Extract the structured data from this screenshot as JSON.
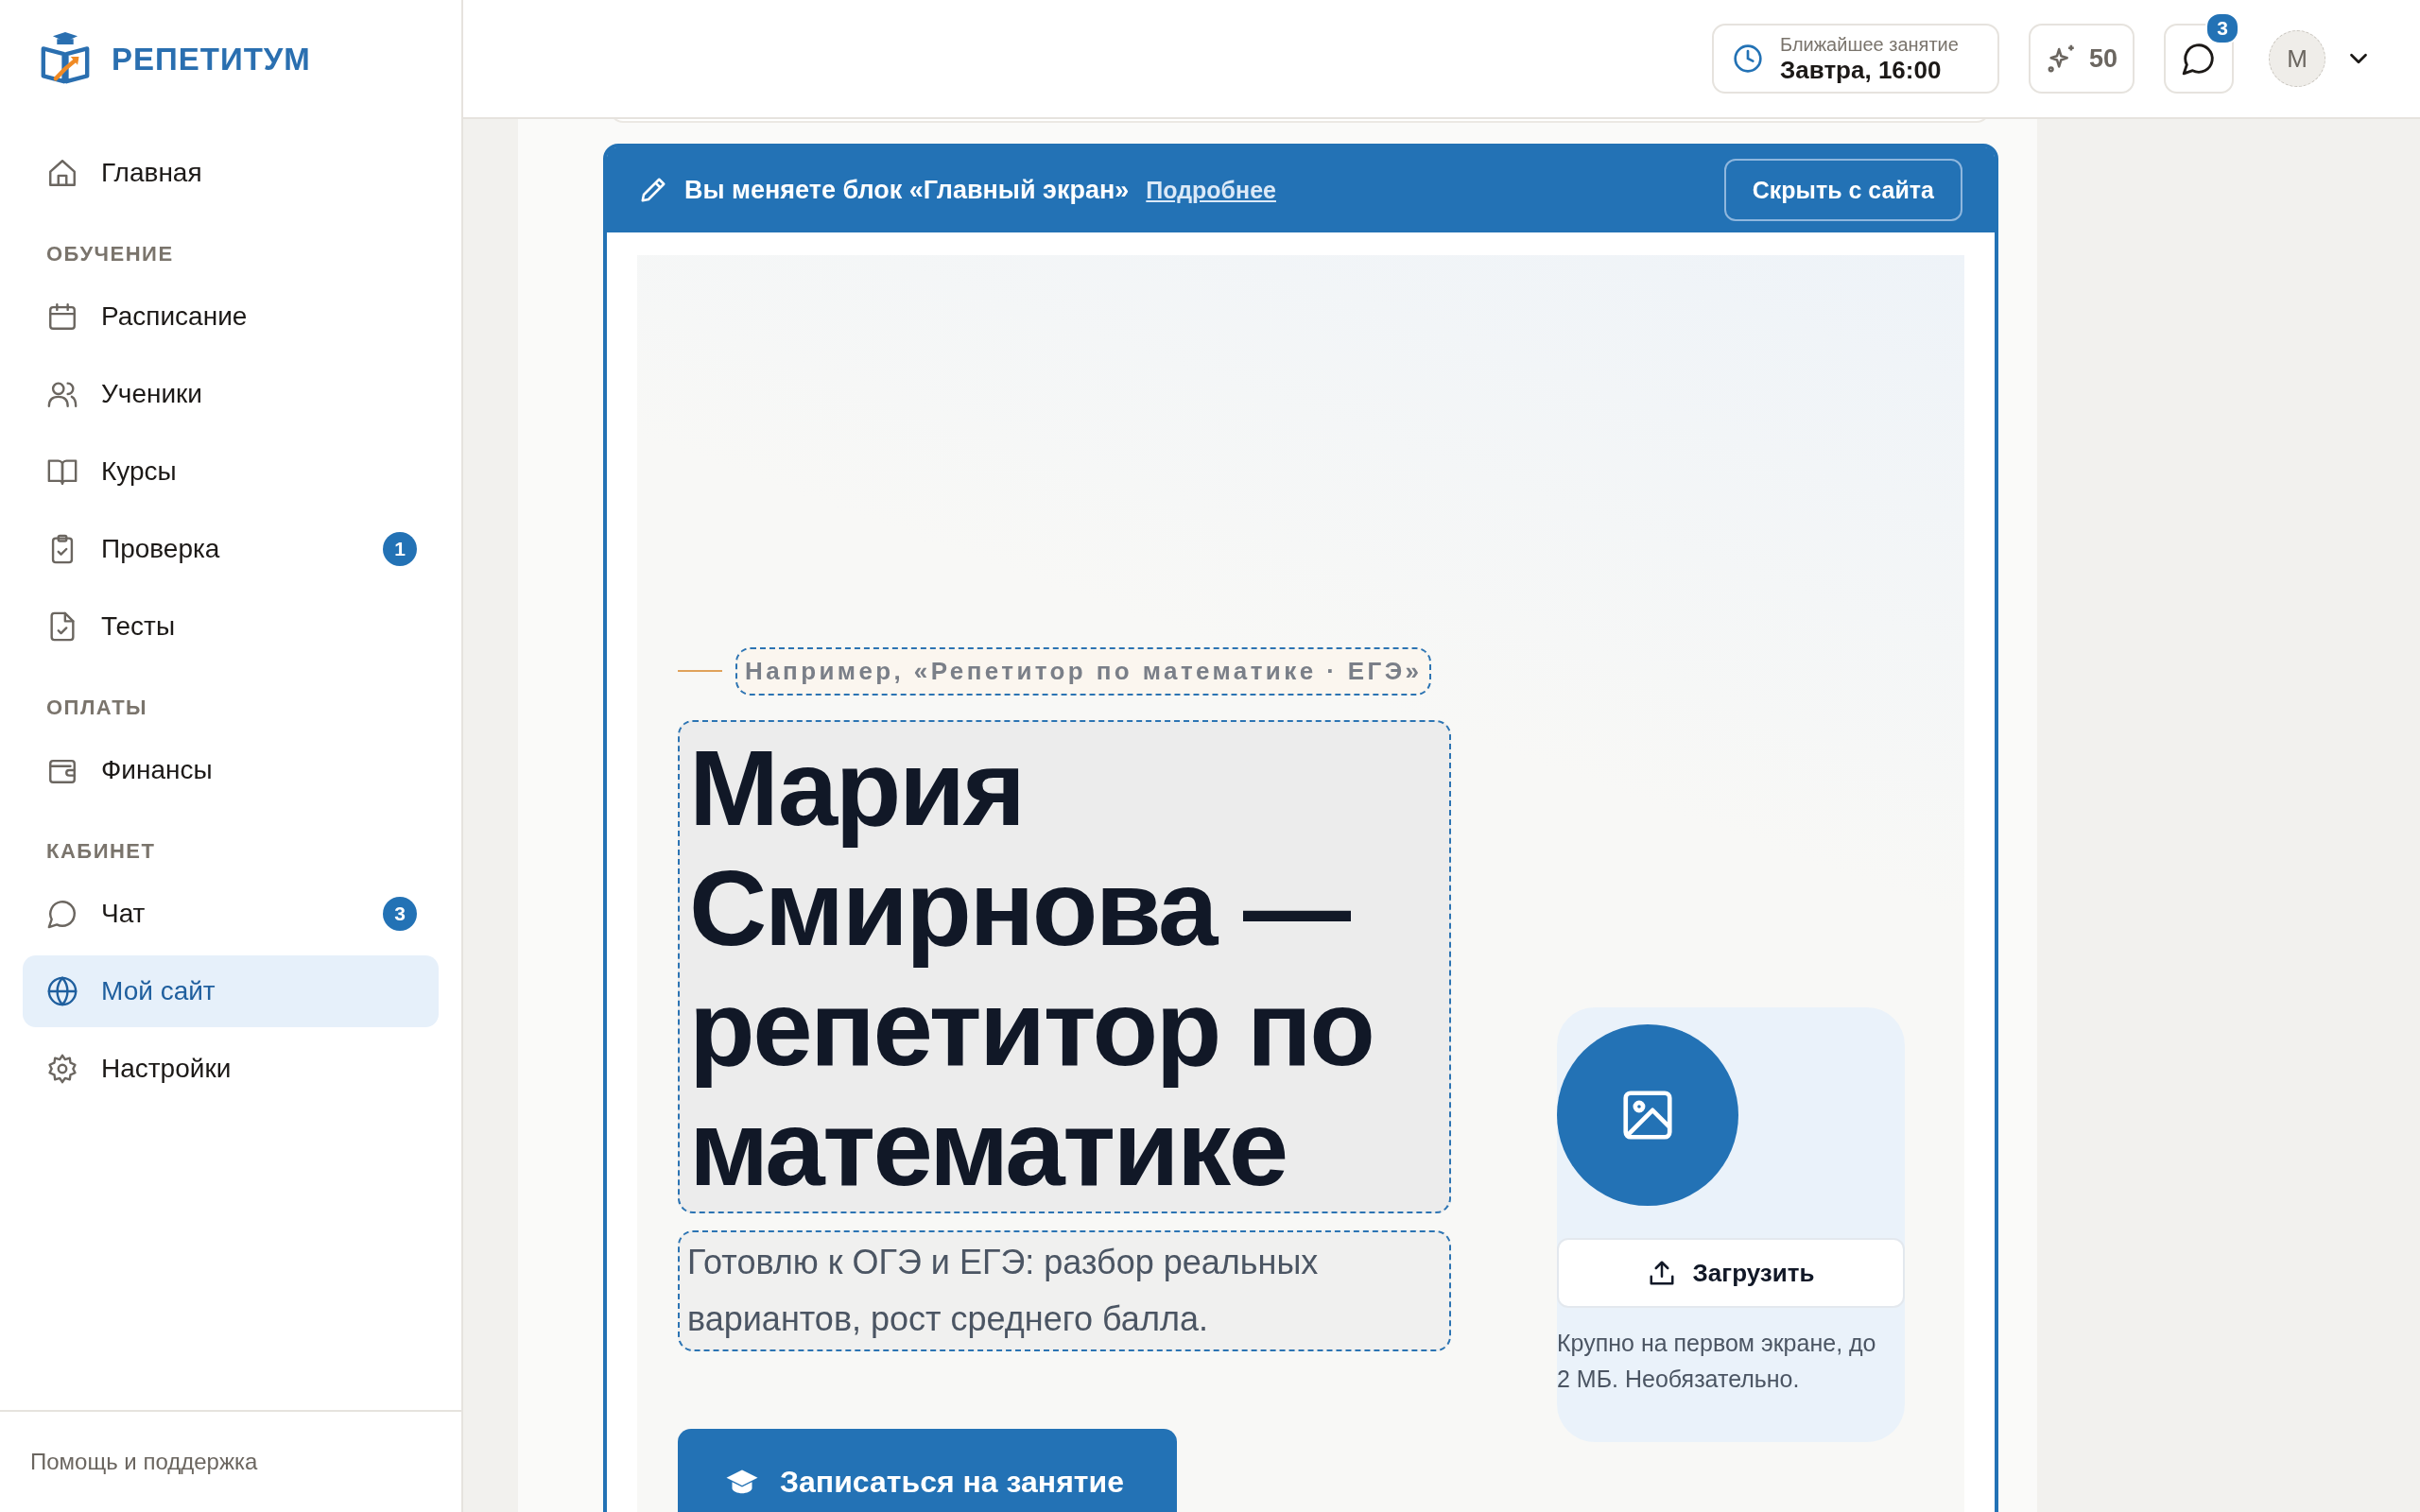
{
  "brand": {
    "name": "РЕПЕТИТУМ"
  },
  "nav": [
    {
      "kind": "item",
      "label": "Главная",
      "selected": false
    },
    {
      "kind": "heading",
      "label": "ОБУЧЕНИЕ"
    },
    {
      "kind": "item",
      "label": "Расписание",
      "selected": false
    },
    {
      "kind": "item",
      "label": "Ученики",
      "selected": false
    },
    {
      "kind": "item",
      "label": "Курсы",
      "selected": false
    },
    {
      "kind": "item",
      "label": "Проверка",
      "selected": false,
      "badge": "1"
    },
    {
      "kind": "item",
      "label": "Тесты",
      "selected": false
    },
    {
      "kind": "heading",
      "label": "ОПЛАТЫ"
    },
    {
      "kind": "item",
      "label": "Финансы",
      "selected": false
    },
    {
      "kind": "heading",
      "label": "КАБИНЕТ"
    },
    {
      "kind": "item",
      "label": "Чат",
      "selected": false,
      "badge": "3"
    },
    {
      "kind": "item",
      "label": "Мой сайт",
      "selected": true
    },
    {
      "kind": "item",
      "label": "Настройки",
      "selected": false
    }
  ],
  "sidebar_footer": {
    "link": "Помощь и поддержка"
  },
  "header": {
    "next_lesson": {
      "label": "Ближайшее занятие",
      "value": "Завтра, 16:00"
    },
    "points": "50",
    "chat_badge": "3",
    "avatar": "М"
  },
  "editor_bar": {
    "message": "Вы меняете блок «Главный экран»",
    "link": "Подробнее",
    "button": "Скрыть с сайта"
  },
  "hero": {
    "eyebrow": "Например, «Репетитор по математике · ЕГЭ»",
    "title": "Мария Смирнова — репетитор по математике",
    "subtitle": "Готовлю к ОГЭ и ЕГЭ: разбор реальных вариантов, рост среднего балла.",
    "cta": "Записаться на занятие"
  },
  "image_upload": {
    "button": "Загрузить",
    "hint": "Крупно на первом экране, до 2 МБ. Необязательно."
  }
}
